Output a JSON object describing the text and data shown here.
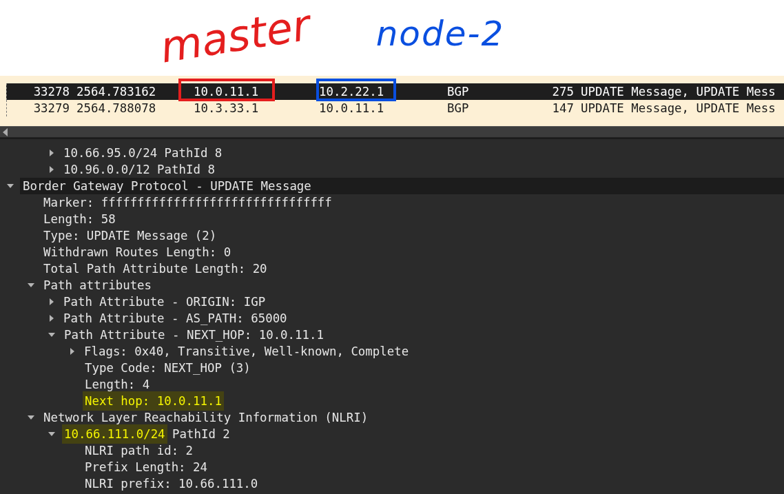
{
  "annotations": [
    {
      "text": "master",
      "color": "#e41e1e"
    },
    {
      "text": "node-2",
      "color": "#0a4fe0"
    }
  ],
  "packets": [
    {
      "selected": true,
      "cells": [
        {
          "text": "33278"
        },
        {
          "text": "2564.783162"
        },
        {
          "text": "10.0.11.1",
          "color": "#e41e1e"
        },
        {
          "text": "10.2.22.1",
          "color": "#0a4fe0"
        },
        {
          "text": "BGP"
        },
        {
          "text": "275"
        },
        {
          "text": "UPDATE Message, UPDATE Mess"
        }
      ]
    },
    {
      "selected": false,
      "cells": [
        {
          "text": "33279"
        },
        {
          "text": "2564.788078"
        },
        {
          "text": "10.3.33.1"
        },
        {
          "text": "10.0.11.1"
        },
        {
          "text": "BGP"
        },
        {
          "text": "147"
        },
        {
          "text": "UPDATE Message, UPDATE Mess"
        }
      ]
    }
  ],
  "details": [
    {
      "children": [
        {
          "children": [
            {
              "segments": [
                {
                  "text": "10.66.95.0/24 PathId 8",
                  "highlighted": false
                }
              ],
              "expanded": false,
              "selected": false
            },
            {
              "segments": [
                {
                  "text": "10.96.0.0/12 PathId 8",
                  "highlighted": false
                }
              ],
              "expanded": false,
              "selected": false
            }
          ]
        }
      ]
    },
    {
      "segments": [
        {
          "text": "Border Gateway Protocol - UPDATE Message",
          "highlighted": false
        }
      ],
      "expanded": true,
      "selected": true,
      "children": [
        {
          "segments": [
            {
              "text": "Marker: ffffffffffffffffffffffffffffffff",
              "highlighted": false
            }
          ],
          "selected": false
        },
        {
          "segments": [
            {
              "text": "Length: 58",
              "highlighted": false
            }
          ],
          "selected": false
        },
        {
          "segments": [
            {
              "text": "Type: UPDATE Message (2)",
              "highlighted": false
            }
          ],
          "selected": false
        },
        {
          "segments": [
            {
              "text": "Withdrawn Routes Length: 0",
              "highlighted": false
            }
          ],
          "selected": false
        },
        {
          "segments": [
            {
              "text": "Total Path Attribute Length: 20",
              "highlighted": false
            }
          ],
          "selected": false
        },
        {
          "segments": [
            {
              "text": "Path attributes",
              "highlighted": false
            }
          ],
          "expanded": true,
          "selected": false,
          "children": [
            {
              "segments": [
                {
                  "text": "Path Attribute - ORIGIN: IGP",
                  "highlighted": false
                }
              ],
              "expanded": false,
              "selected": false
            },
            {
              "segments": [
                {
                  "text": "Path Attribute - AS_PATH: 65000",
                  "highlighted": false
                }
              ],
              "expanded": false,
              "selected": false
            },
            {
              "segments": [
                {
                  "text": "Path Attribute - NEXT_HOP: 10.0.11.1",
                  "highlighted": false
                }
              ],
              "expanded": true,
              "selected": false,
              "children": [
                {
                  "segments": [
                    {
                      "text": "Flags: 0x40, Transitive, Well-known, Complete",
                      "highlighted": false
                    }
                  ],
                  "expanded": false,
                  "selected": false
                },
                {
                  "segments": [
                    {
                      "text": "Type Code: NEXT_HOP (3)",
                      "highlighted": false
                    }
                  ],
                  "selected": false
                },
                {
                  "segments": [
                    {
                      "text": "Length: 4",
                      "highlighted": false
                    }
                  ],
                  "selected": false
                },
                {
                  "segments": [
                    {
                      "text": "Next hop: 10.0.11.1",
                      "highlighted": true
                    }
                  ],
                  "selected": false
                }
              ]
            }
          ]
        },
        {
          "segments": [
            {
              "text": "Network Layer Reachability Information (NLRI)",
              "highlighted": false
            }
          ],
          "expanded": true,
          "selected": false,
          "children": [
            {
              "segments": [
                {
                  "text": "10.66.111.0/24",
                  "highlighted": true
                },
                {
                  "text": " PathId 2",
                  "highlighted": false
                }
              ],
              "expanded": true,
              "selected": false,
              "children": [
                {
                  "segments": [
                    {
                      "text": "NLRI path id: 2",
                      "highlighted": false
                    }
                  ],
                  "selected": false
                },
                {
                  "segments": [
                    {
                      "text": "Prefix Length: 24",
                      "highlighted": false
                    }
                  ],
                  "selected": false
                },
                {
                  "segments": [
                    {
                      "text": "NLRI prefix: 10.66.111.0",
                      "highlighted": false
                    }
                  ],
                  "selected": false
                }
              ]
            }
          ]
        }
      ]
    }
  ]
}
